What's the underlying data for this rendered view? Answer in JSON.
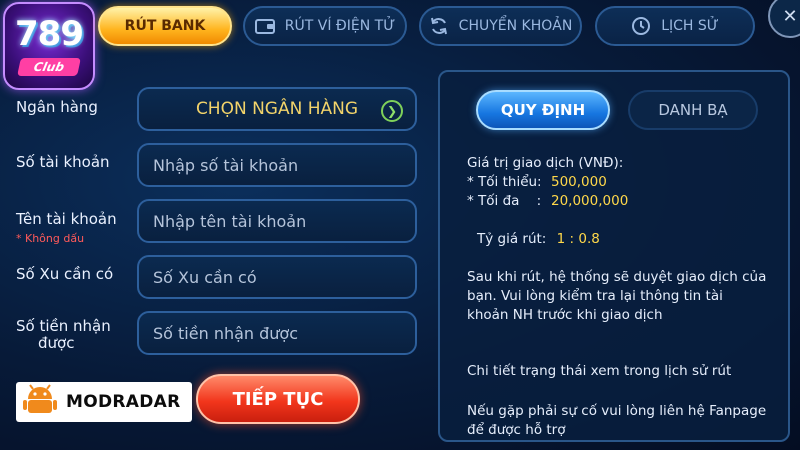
{
  "logo": {
    "number": "789",
    "sub": "Club"
  },
  "tabs": [
    {
      "label": "RÚT BANK",
      "active": true
    },
    {
      "label": "RÚT VÍ ĐIỆN TỬ",
      "active": false
    },
    {
      "label": "CHUYỂN KHOẢN",
      "active": false
    },
    {
      "label": "LỊCH SỬ",
      "active": false
    }
  ],
  "close_icon": "close-icon",
  "form": {
    "bank_label": "Ngân hàng",
    "bank_select": "CHỌN NGÂN HÀNG",
    "account_number_label": "Số tài khoản",
    "account_number_placeholder": "Nhập số tài khoản",
    "account_name_label": "Tên tài khoản",
    "account_name_note": "* Không dấu",
    "account_name_placeholder": "Nhập tên tài khoản",
    "coins_label": "Số Xu cần có",
    "coins_placeholder": "Số Xu cần có",
    "received_label_line1": "Số tiền nhận",
    "received_label_line2": "được",
    "received_placeholder": "Số tiền nhận được",
    "continue_label": "TIẾP TỤC"
  },
  "watermark": {
    "text": "MODRADAR"
  },
  "panel": {
    "tabs": [
      {
        "label": "QUY ĐỊNH",
        "active": true
      },
      {
        "label": "DANH BẠ",
        "active": false
      }
    ],
    "value_title": "Giá trị giao dịch (VNĐ):",
    "min_label": "* Tối thiểu:",
    "min_value": "500,000",
    "max_label": "* Tối đa    :",
    "max_value": "20,000,000",
    "rate_label": "Tỷ giá rút:",
    "rate_value": "1 : 0.8",
    "note1": "Sau khi rút, hệ thống sẽ duyệt giao dịch của bạn. Vui lòng kiểm tra lại thông tin tài khoản NH trước khi giao dịch",
    "note2": "Chi tiết trạng thái xem trong lịch sử rút",
    "note3": "Nếu gặp phải sự cố vui lòng liên hệ Fanpage để được hỗ trợ"
  },
  "colors": {
    "accent_orange": "#ffb41e",
    "accent_blue": "#1676e0",
    "highlight_yellow": "#ffd84a",
    "warning_red": "#ff5a5a",
    "button_red": "#f2361c"
  }
}
